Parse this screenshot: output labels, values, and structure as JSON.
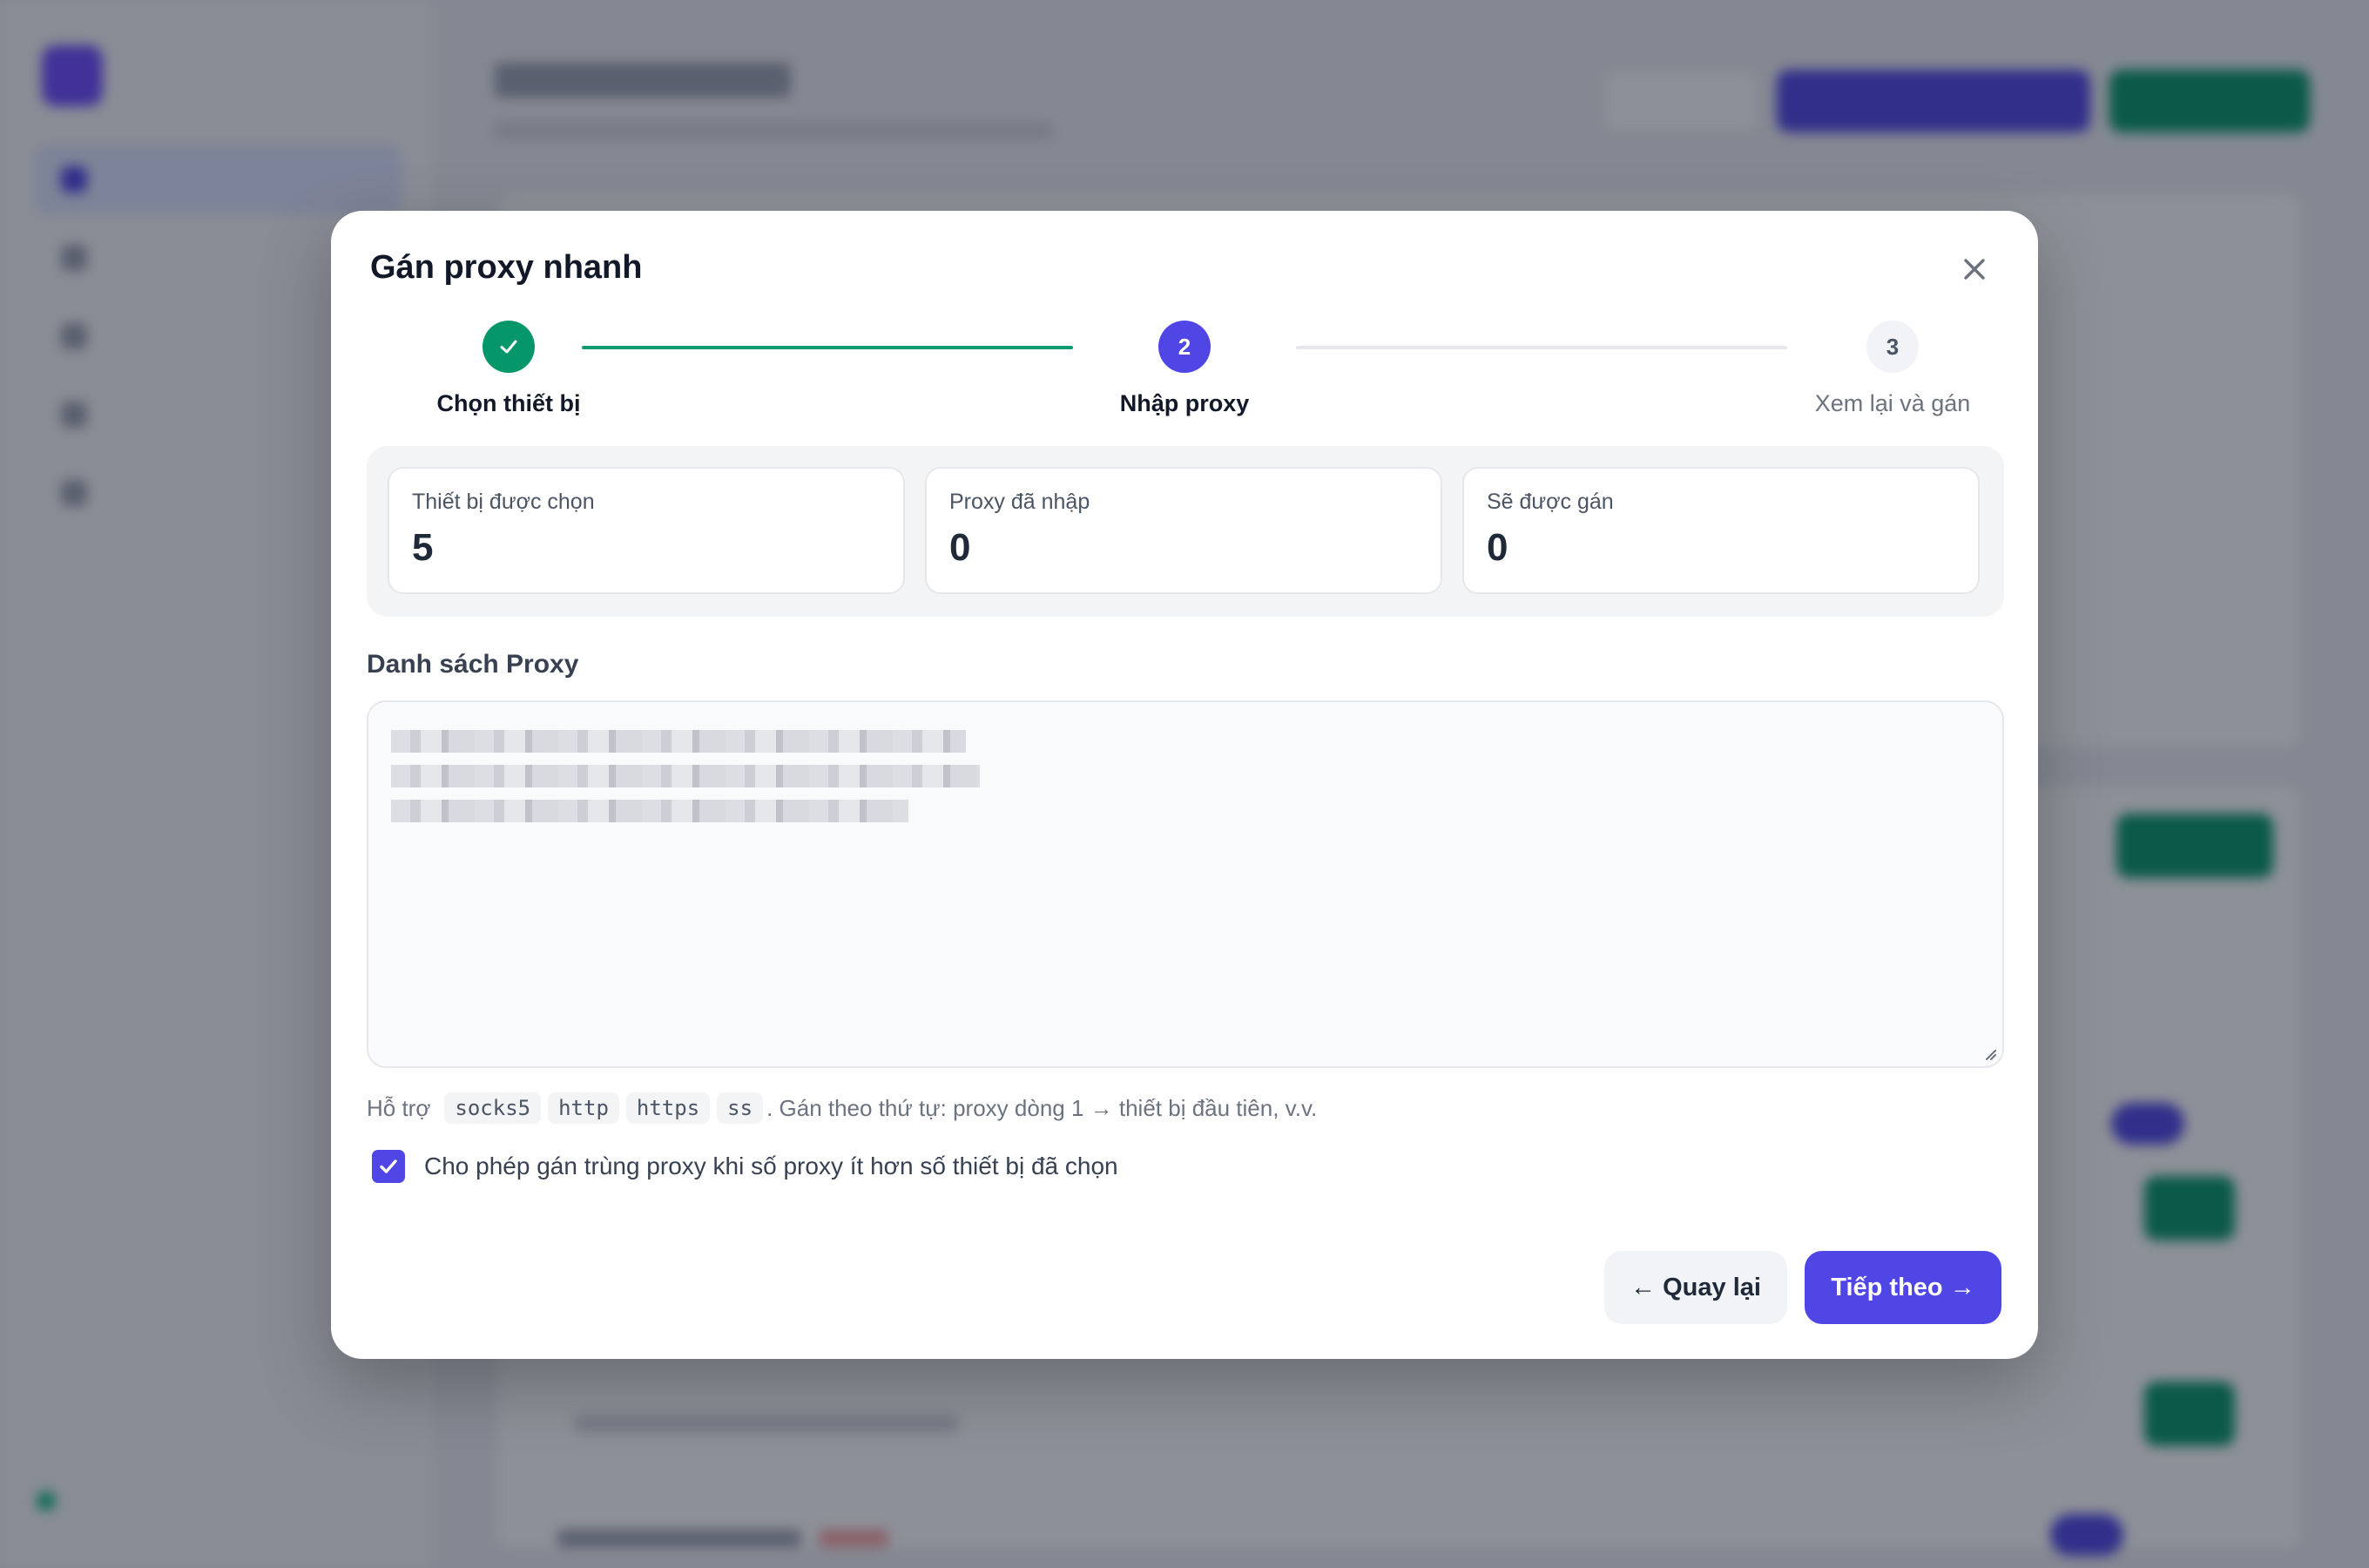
{
  "modal": {
    "title": "Gán proxy nhanh",
    "close_icon": "close-icon"
  },
  "stepper": {
    "steps": [
      {
        "number": "1",
        "label": "Chọn thiết bị",
        "state": "done"
      },
      {
        "number": "2",
        "label": "Nhập proxy",
        "state": "active"
      },
      {
        "number": "3",
        "label": "Xem lại và gán",
        "state": "pending"
      }
    ]
  },
  "stats": [
    {
      "label": "Thiết bị được chọn",
      "value": "5"
    },
    {
      "label": "Proxy đã nhập",
      "value": "0"
    },
    {
      "label": "Sẽ được gán",
      "value": "0"
    }
  ],
  "proxy_list": {
    "label": "Danh sách Proxy",
    "value": ""
  },
  "help": {
    "prefix": "Hỗ trợ",
    "protocols": [
      "socks5",
      "http",
      "https",
      "ss"
    ],
    "suffix": ". Gán theo thứ tự: proxy dòng 1 → thiết bị đầu tiên, v.v."
  },
  "allow_duplicate": {
    "checked": true,
    "label": "Cho phép gán trùng proxy khi số proxy ít hơn số thiết bị đã chọn"
  },
  "footer": {
    "back_label": "← Quay lại",
    "next_label": "Tiếp theo →"
  },
  "colors": {
    "primary": "#4f46e5",
    "success": "#059669",
    "overlay": "rgba(17,24,39,0.48)"
  }
}
